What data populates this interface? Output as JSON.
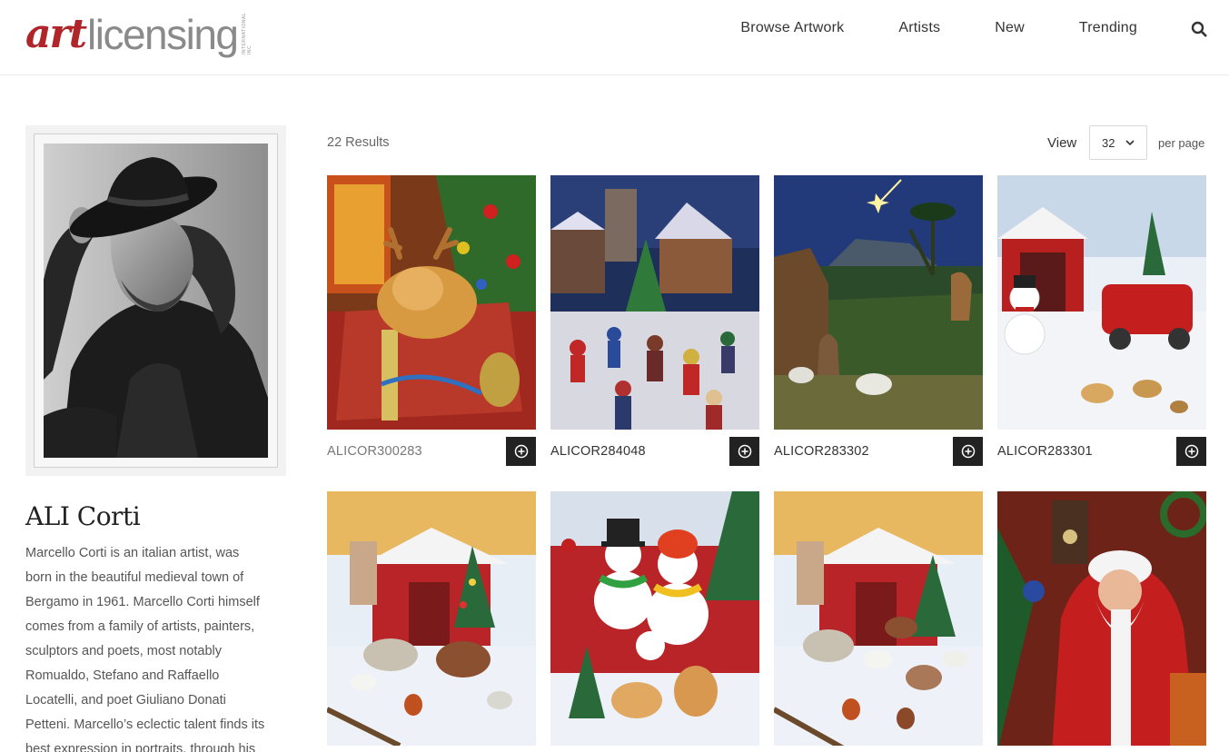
{
  "header": {
    "logo_art": "art",
    "logo_licensing": "licensing",
    "logo_sub": "INTERNATIONAL INC",
    "nav": [
      "Browse Artwork",
      "Artists",
      "New",
      "Trending"
    ],
    "search_icon": "search-icon"
  },
  "artist": {
    "name": "ALI Corti",
    "bio_lines": [
      "Marcello Corti is an italian artist, was",
      "born in the beautiful medieval town of",
      "Bergamo in 1961. Marcello Corti himself",
      "comes from a family of artists, painters,",
      "sculptors and poets, most notably",
      "Romualdo, Stefano and Raffaello",
      "Locatelli, and poet Giuliano Donati",
      "Petteni. Marcello’s eclectic talent finds its",
      "best expression in portraits, through his"
    ]
  },
  "results": {
    "count_text": "22 Results",
    "view_label": "View",
    "per_page_value": "32",
    "per_page_label": "per page"
  },
  "artworks": [
    {
      "code": "ALICOR300283",
      "subject": "puppy-with-reindeer-antlers-in-gift-box"
    },
    {
      "code": "ALICOR284048",
      "subject": "christmas-village-market"
    },
    {
      "code": "ALICOR283302",
      "subject": "nativity-star-of-bethlehem"
    },
    {
      "code": "ALICOR283301",
      "subject": "snowman-red-barn-red-truck"
    },
    {
      "code": "",
      "subject": "red-barn-farm-animals-christmas"
    },
    {
      "code": "",
      "subject": "snowman-couple-with-puppies"
    },
    {
      "code": "",
      "subject": "red-barn-farm-animals-christmas-2"
    },
    {
      "code": "",
      "subject": "santa-claus-hanging-ornament"
    }
  ],
  "colors": {
    "brand_red": "#b0252a",
    "logo_gray": "#8a8a8a",
    "button_dark": "#222222"
  }
}
